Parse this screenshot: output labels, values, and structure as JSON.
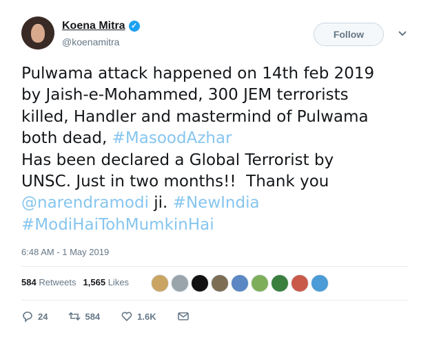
{
  "user": {
    "display_name": "Koena Mitra",
    "handle": "@koenamitra",
    "verified_glyph": "✓"
  },
  "follow_label": "Follow",
  "tweet": {
    "lines": [
      {
        "text": "Pulwama attack happened on 14th feb 2019"
      },
      {
        "text": "by Jaish-e-Mohammed, 300 JEM terrorists"
      },
      {
        "text": "killed, Handler and mastermind of Pulwama"
      },
      {
        "text": "both dead, ",
        "tag": "#MasoodAzhar"
      },
      {
        "text": "Has been declared a Global Terrorist by"
      },
      {
        "text": "UNSC. Just in two months!!  Thank you"
      }
    ],
    "mention": "@narendramodi",
    "mention_suffix": " ji. ",
    "tag_newindia": "#NewIndia",
    "tag_last": "#ModiHaiTohMumkinHai"
  },
  "timestamp": "6:48 AM - 1 May 2019",
  "stats": {
    "retweets_count": "584",
    "retweets_label": "Retweets",
    "likes_count": "1,565",
    "likes_label": "Likes"
  },
  "likers": [
    {
      "name": "liker-1",
      "color": "#c9a463"
    },
    {
      "name": "liker-2",
      "color": "#9aa4ab"
    },
    {
      "name": "liker-3",
      "color": "#111111"
    },
    {
      "name": "liker-4",
      "color": "#7d6d55"
    },
    {
      "name": "liker-5",
      "color": "#5b87c2"
    },
    {
      "name": "liker-6",
      "color": "#7fae5b"
    },
    {
      "name": "liker-7",
      "color": "#3a7f3e"
    },
    {
      "name": "liker-8",
      "color": "#c95a4a"
    },
    {
      "name": "liker-9",
      "color": "#4a9bd6"
    }
  ],
  "actions": {
    "reply_count": "24",
    "retweet_count": "584",
    "like_count": "1.6K"
  },
  "colors": {
    "link": "#86c5ef",
    "verified": "#1da1f2",
    "muted": "#657786"
  }
}
